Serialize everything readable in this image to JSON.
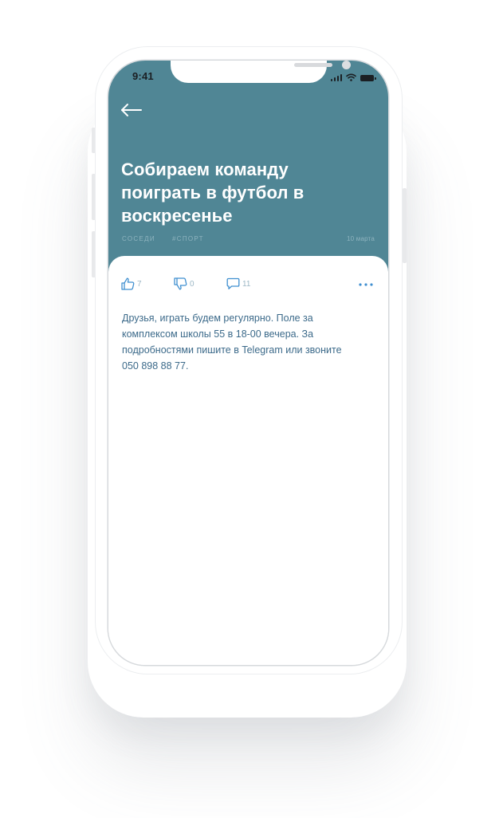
{
  "status_bar": {
    "time": "9:41"
  },
  "header": {
    "background_color": "#508695",
    "back_icon": "arrow-left-icon",
    "title": "Собираем команду поиграть в футбол в воскресенье",
    "tags": [
      "соседи",
      "#спорт"
    ],
    "date": "10 марта"
  },
  "reactions": {
    "likes": {
      "icon": "thumbs-up-icon",
      "count": "7"
    },
    "dislikes": {
      "icon": "thumbs-down-icon",
      "count": "0"
    },
    "comments": {
      "icon": "comment-icon",
      "count": "11"
    },
    "more_icon": "more-dots-icon",
    "accent_color": "#3f8fd0"
  },
  "post": {
    "text": "Друзья, играть будем регулярно. Поле за комплексом школы 55 в 18-00 вечера. За подробностями пишите в Telegram или звоните 050 898 88 77.",
    "text_color": "#3c6a8a"
  }
}
